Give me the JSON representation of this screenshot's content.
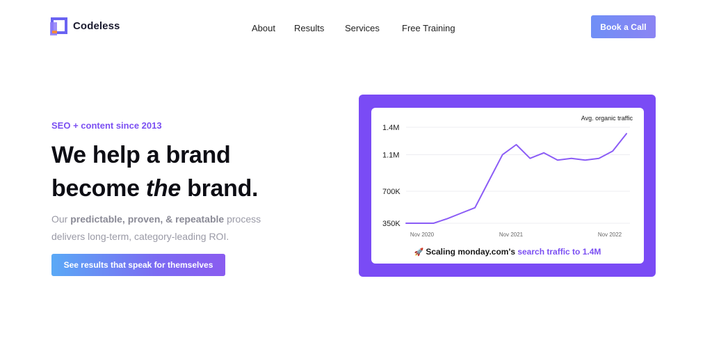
{
  "header": {
    "brand": "Codeless",
    "nav": [
      "About",
      "Results",
      "Services",
      "Free Training"
    ],
    "cta": "Book a Call"
  },
  "hero": {
    "eyebrow": "SEO + content since 2013",
    "headline_line1": "We help a brand",
    "headline_line2_pre": "become ",
    "headline_line2_em": "the",
    "headline_line2_post": " brand.",
    "desc_pre": "Our ",
    "desc_bold": "predictable, proven, & repeatable",
    "desc_post": " process delivers long-term, category-leading ROI.",
    "cta": "See results that speak for themselves"
  },
  "caption": {
    "icon": "rocket-icon",
    "text_pre": "Scaling monday.com's ",
    "text_highlight": "search traffic to 1.4M"
  },
  "colors": {
    "accent": "#7b4ff2",
    "frame": "#7a4bf5",
    "line": "#8b5cf6"
  },
  "chart_data": {
    "type": "line",
    "legend": "Avg. organic traffic",
    "y_ticks": [
      "1.4M",
      "1.1M",
      "700K",
      "350K"
    ],
    "y_tick_values": [
      1400000,
      1100000,
      700000,
      350000
    ],
    "x_ticks": [
      "Nov 2020",
      "Nov 2021",
      "Nov 2022"
    ],
    "ylim": [
      350000,
      1400000
    ],
    "grid": true,
    "series": [
      {
        "values": [
          350000,
          350000,
          350000,
          400000,
          460000,
          520000,
          810000,
          1100000,
          1210000,
          1060000,
          1120000,
          1040000,
          1060000,
          1040000,
          1060000,
          1140000,
          1330000
        ]
      }
    ]
  }
}
